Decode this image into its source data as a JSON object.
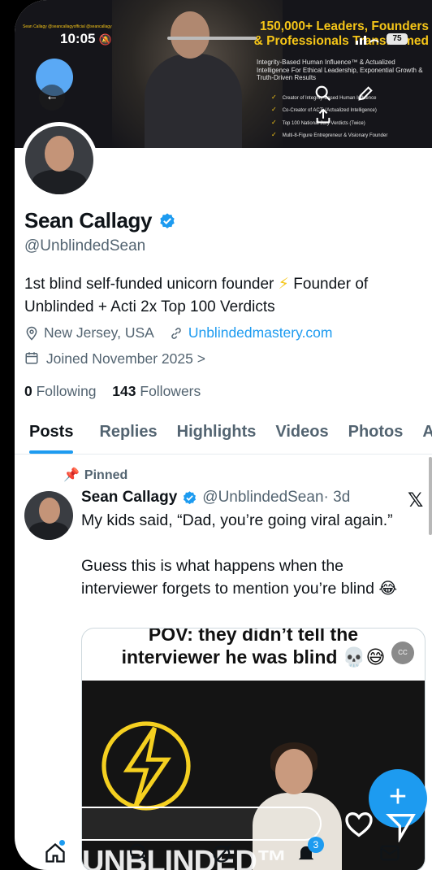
{
  "status_bar": {
    "time": "10:05",
    "battery": "75"
  },
  "banner": {
    "headline_line1": "150,000+ Leaders, Founders",
    "headline_line2": "& Professionals Transformed",
    "subtitle": "Integrity-Based Human Influence™ & Actualized Intelligence For Ethical Leadership, Exponential Growth & Truth-Driven Results",
    "bullets": [
      "Creator of Integrity-Based Human Influence",
      "Co-Creator of ACTi (Actualized Intelligence)",
      "Top 100 National Jury Verdicts (Twice)",
      "Multi-8-Figure Entrepreneur & Visionary Founder"
    ],
    "social_handles": "Sean Callagy  @seancallagyofficial  @seancallagy"
  },
  "profile": {
    "name": "Sean Callagy",
    "handle": "@UnblindedSean",
    "bio_part1": "1st blind self-funded unicorn founder ",
    "bio_bolt": "⚡",
    "bio_part2": " Founder of Unblinded + Acti 2x Top 100 Verdicts",
    "location": "New Jersey, USA",
    "website": "Unblindedmastery.com",
    "joined": "Joined November 2025",
    "following_count": "0",
    "following_label": "Following",
    "followers_count": "143",
    "followers_label": "Followers"
  },
  "tabs": [
    {
      "label": "Posts"
    },
    {
      "label": "Replies"
    },
    {
      "label": "Highlights"
    },
    {
      "label": "Videos"
    },
    {
      "label": "Photos"
    },
    {
      "label": "Articles"
    }
  ],
  "post": {
    "pinned_label": "Pinned",
    "author_name": "Sean Callagy",
    "author_handle": "@UnblindedSean",
    "time": "· 3d",
    "text_p1": "My kids said, “Dad, you’re going viral again.”",
    "text_p2": "Guess this is what happens when the interviewer forgets to mention you’re blind 😂",
    "media_caption_line1": "POV: they didn’t tell the",
    "media_caption_line2": "interviewer he was blind 💀😅",
    "media_brand": "UNBLINDED™",
    "cc_label": "CC"
  },
  "bottom_nav": {
    "notifications_badge": "3"
  },
  "colors": {
    "accent": "#1d9bf0",
    "banner_gold": "#f5c518",
    "secondary_text": "#536471"
  }
}
